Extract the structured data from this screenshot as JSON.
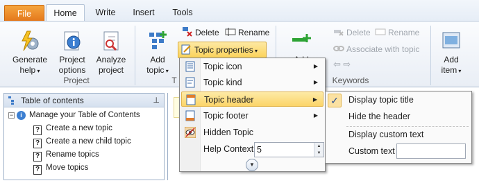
{
  "tabs": [
    "File",
    "Home",
    "Write",
    "Insert",
    "Tools"
  ],
  "ribbon": {
    "generate_help": "Generate\nhelp",
    "project_options": "Project\noptions",
    "analyze_project": "Analyze\nproject",
    "project_group": "Project",
    "add_topic": "Add\ntopic",
    "delete": "Delete",
    "rename": "Rename",
    "topic_properties": "Topic properties",
    "add_keyword": "Add",
    "kw_delete": "Delete",
    "kw_rename": "Rename",
    "associate": "Associate with topic",
    "keywords_group": "Keywords",
    "add_item": "Add\nitem",
    "topics_group_fragment": "T"
  },
  "toc": {
    "title": "Table of contents",
    "items": [
      "Manage your Table of Contents",
      "Create a new topic",
      "Create a new child topic",
      "Rename topics",
      "Move topics"
    ]
  },
  "menu": {
    "items": [
      "Topic icon",
      "Topic kind",
      "Topic header",
      "Topic footer",
      "Hidden Topic",
      "Help Context"
    ],
    "help_context_value": "5"
  },
  "submenu": {
    "items": [
      "Display topic title",
      "Hide the header",
      "Display custom text",
      "Custom text"
    ]
  },
  "colors": {
    "file_tab": "#e4781c",
    "highlight": "#fbd468",
    "accent_blue": "#2b4f91"
  }
}
